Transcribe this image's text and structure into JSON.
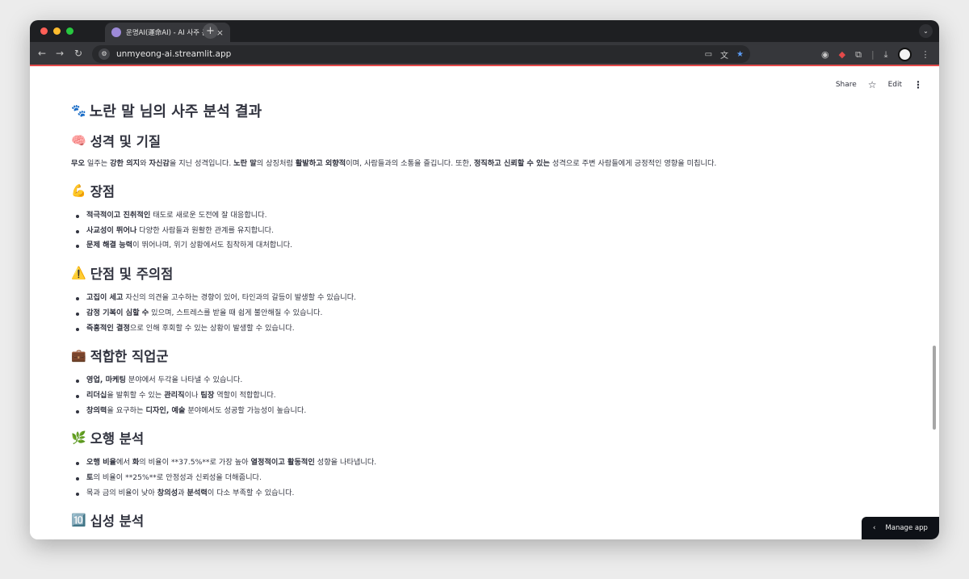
{
  "browser": {
    "tab_title": "운명AI(運命AI) - AI 사주 분석 & 운세",
    "tab_close": "×",
    "new_tab": "+",
    "url": "unmyeong-ai.streamlit.app"
  },
  "header": {
    "share_label": "Share",
    "edit_label": "Edit"
  },
  "page": {
    "title_emoji": "🐾",
    "title": "노란 말 님의 사주 분석 결과",
    "sections": {
      "personality": {
        "emoji": "🧠",
        "heading": "성격 및 기질",
        "p": [
          {
            "b": "무오"
          },
          {
            "t": " 일주는 "
          },
          {
            "b": "강한 의지"
          },
          {
            "t": "와 "
          },
          {
            "b": "자신감"
          },
          {
            "t": "을 지닌 성격입니다. "
          },
          {
            "b": "노란 말"
          },
          {
            "t": "의 상징처럼 "
          },
          {
            "b": "활발하고 외향적"
          },
          {
            "t": "이며, 사람들과의 소통을 즐깁니다. 또한, "
          },
          {
            "b": "정직하고 신뢰할 수 있는"
          },
          {
            "t": " 성격으로 주변 사람들에게 긍정적인 영향을 미칩니다."
          }
        ]
      },
      "strengths": {
        "emoji": "💪",
        "heading": "장점",
        "items": [
          [
            {
              "b": "적극적이고 진취적인"
            },
            {
              "t": " 태도로 새로운 도전에 잘 대응합니다."
            }
          ],
          [
            {
              "b": "사교성이 뛰어나"
            },
            {
              "t": " 다양한 사람들과 원활한 관계를 유지합니다."
            }
          ],
          [
            {
              "b": "문제 해결 능력"
            },
            {
              "t": "이 뛰어나며, 위기 상황에서도 침착하게 대처합니다."
            }
          ]
        ]
      },
      "weaknesses": {
        "emoji": "⚠️",
        "heading": "단점 및 주의점",
        "items": [
          [
            {
              "b": "고집이 세고"
            },
            {
              "t": " 자신의 의견을 고수하는 경향이 있어, 타인과의 갈등이 발생할 수 있습니다."
            }
          ],
          [
            {
              "b": "감정 기복이 심할 수"
            },
            {
              "t": " 있으며, 스트레스를 받을 때 쉽게 불안해질 수 있습니다."
            }
          ],
          [
            {
              "b": "즉흥적인 결정"
            },
            {
              "t": "으로 인해 후회할 수 있는 상황이 발생할 수 있습니다."
            }
          ]
        ]
      },
      "careers": {
        "emoji": "💼",
        "heading": "적합한 직업군",
        "items": [
          [
            {
              "b": "영업, 마케팅"
            },
            {
              "t": " 분야에서 두각을 나타낼 수 있습니다."
            }
          ],
          [
            {
              "b": "리더십"
            },
            {
              "t": "을 발휘할 수 있는 "
            },
            {
              "b": "관리직"
            },
            {
              "t": "이나 "
            },
            {
              "b": "팀장"
            },
            {
              "t": " 역할이 적합합니다."
            }
          ],
          [
            {
              "b": "창의력"
            },
            {
              "t": "을 요구하는 "
            },
            {
              "b": "디자인, 예술"
            },
            {
              "t": " 분야에서도 성공할 가능성이 높습니다."
            }
          ]
        ]
      },
      "five_elements": {
        "emoji": "🌿",
        "heading": "오행 분석",
        "items": [
          [
            {
              "b": "오행 비율"
            },
            {
              "t": "에서 "
            },
            {
              "b": "화"
            },
            {
              "t": "의 비율이 **37.5%**로 가장 높아 "
            },
            {
              "b": "열정적이고 활동적인"
            },
            {
              "t": " 성향을 나타냅니다."
            }
          ],
          [
            {
              "b": "토"
            },
            {
              "t": "의 비율이 **25%**로 안정성과 신뢰성을 더해줍니다."
            }
          ],
          [
            {
              "t": "목과 금의 비율이 낮아 "
            },
            {
              "b": "창의성"
            },
            {
              "t": "과 "
            },
            {
              "b": "분석력"
            },
            {
              "t": "이 다소 부족할 수 있습니다."
            }
          ]
        ]
      },
      "ten_gods": {
        "emoji": "🔟",
        "heading": "십성 분석"
      }
    }
  },
  "manage_app": {
    "chevron": "‹",
    "label": "Manage app"
  },
  "colors": {
    "titlebar": "#1e1f22",
    "toolbar": "#36373b",
    "accent_line": "#e44a4a",
    "text": "#31333f",
    "manage_bg": "#0e1117"
  }
}
